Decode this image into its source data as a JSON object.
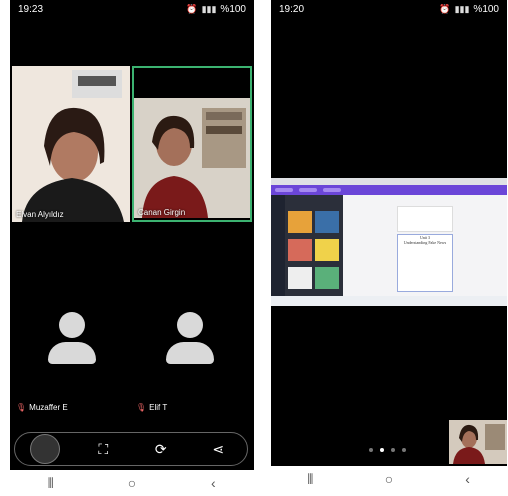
{
  "left_phone": {
    "status": {
      "time": "19:23",
      "battery": "%100"
    },
    "participants": [
      {
        "name": "Elvan Alyıldız",
        "has_video": true
      },
      {
        "name": "Canan Girgin",
        "has_video": true,
        "active": true
      },
      {
        "name": "Muzaffer E",
        "has_video": false,
        "muted": true
      },
      {
        "name": "Elif T",
        "has_video": false,
        "muted": true
      }
    ],
    "toolbar": {
      "icons": [
        "self-view",
        "fullscreen-icon",
        "rotate-screen-icon",
        "share-icon"
      ],
      "glyphs": {
        "fullscreen": "⛶",
        "rotate": "⟳",
        "share": "⋖"
      }
    }
  },
  "right_phone": {
    "status": {
      "time": "19:20",
      "battery": "%100"
    },
    "shared_screen": {
      "document_title_line1": "Unit 3",
      "document_title_line2": "Understanding Fake News"
    },
    "pager": {
      "count": 4,
      "active_index": 1
    }
  },
  "nav_glyphs": {
    "recents": "⦀",
    "home": "○",
    "back": "‹"
  },
  "colors": {
    "active_border": "#3cb371",
    "canva_purple": "#6b46d8"
  }
}
